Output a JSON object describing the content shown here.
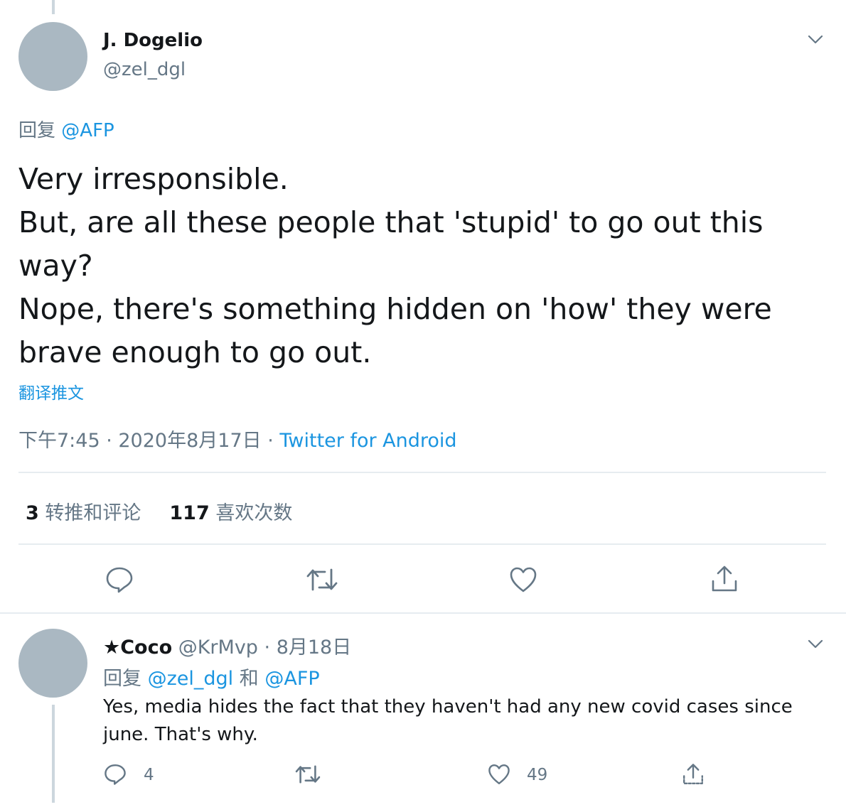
{
  "tweet": {
    "author": {
      "display_name": "J. Dogelio",
      "handle": "@zel_dgl"
    },
    "reply_prefix": "回复",
    "reply_target": "@AFP",
    "text": "Very irresponsible.\nBut, are all these people that 'stupid' to go out this way?\nNope, there's something hidden on 'how' they were brave enough to go out.",
    "translate_label": "翻译推文",
    "timestamp": "下午7:45 · 2020年8月17日",
    "separator": " · ",
    "source": "Twitter for Android",
    "stats": {
      "retweets_count": "3",
      "retweets_label": "转推和评论",
      "likes_count": "117",
      "likes_label": "喜欢次数"
    },
    "actions": [
      "reply-icon",
      "retweet-icon",
      "like-icon",
      "share-icon"
    ]
  },
  "reply": {
    "display_name": "★Coco",
    "handle": "@KrMvp",
    "date": "8月18日",
    "header_separator": " · ",
    "reply_prefix": "回复",
    "reply_target_1": "@zel_dgl",
    "reply_joiner": "和",
    "reply_target_2": "@AFP",
    "text": "Yes, media hides the fact that they haven't had any new covid cases since june. That's why.",
    "reply_count": "4",
    "like_count": "49"
  },
  "colors": {
    "link": "#1b95e0",
    "secondary_text": "#657786",
    "primary_text": "#14171a",
    "avatar": "#aab8c2",
    "divider": "#e6ecf0"
  }
}
